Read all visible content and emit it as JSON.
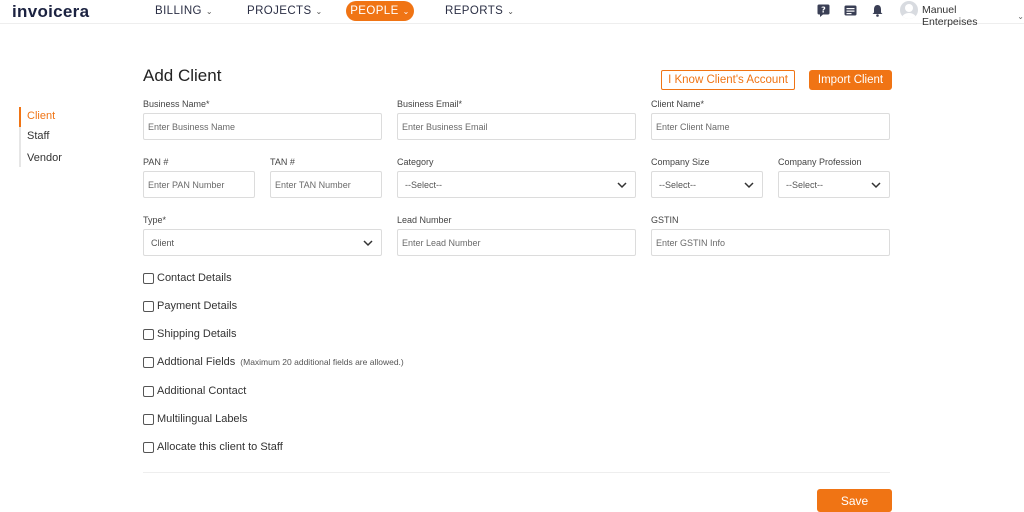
{
  "header": {
    "logo": "invoicera",
    "nav": [
      {
        "label": "BILLING"
      },
      {
        "label": "PROJECTS"
      },
      {
        "label": "PEOPLE"
      },
      {
        "label": "REPORTS"
      }
    ],
    "user_name": "Manuel Enterpeises",
    "icons": [
      "help-icon",
      "message-icon",
      "bell-icon",
      "avatar-icon"
    ]
  },
  "sidebar": {
    "items": [
      {
        "label": "Client"
      },
      {
        "label": "Staff"
      },
      {
        "label": "Vendor"
      }
    ]
  },
  "main": {
    "title": "Add Client",
    "know_account_label": "I Know Client's Account",
    "import_label": "Import Client",
    "fields": {
      "business_name": {
        "label": "Business Name*",
        "placeholder": "Enter Business Name"
      },
      "business_email": {
        "label": "Business Email*",
        "placeholder": "Enter Business Email"
      },
      "client_name": {
        "label": "Client Name*",
        "placeholder": "Enter Client Name"
      },
      "pan": {
        "label": "PAN #",
        "placeholder": "Enter PAN Number"
      },
      "tan": {
        "label": "TAN #",
        "placeholder": "Enter TAN Number"
      },
      "category": {
        "label": "Category",
        "value": "--Select--"
      },
      "company_size": {
        "label": "Company Size",
        "value": "--Select--"
      },
      "company_profession": {
        "label": "Company Profession",
        "value": "--Select--"
      },
      "type": {
        "label": "Type*",
        "value": "Client"
      },
      "lead_number": {
        "label": "Lead Number",
        "placeholder": "Enter Lead Number"
      },
      "gstin": {
        "label": "GSTIN",
        "placeholder": "Enter GSTIN Info"
      }
    },
    "checkboxes": [
      {
        "label": "Contact Details",
        "note": ""
      },
      {
        "label": "Payment Details",
        "note": ""
      },
      {
        "label": "Shipping Details",
        "note": ""
      },
      {
        "label": "Addtional Fields",
        "note": "(Maximum 20 additional fields are allowed.)"
      },
      {
        "label": "Additional Contact",
        "note": ""
      },
      {
        "label": "Multilingual Labels",
        "note": ""
      },
      {
        "label": "Allocate this client to Staff",
        "note": ""
      }
    ],
    "save_label": "Save"
  },
  "colors": {
    "accent": "#f07414",
    "text": "#333333",
    "border": "#dcdcdc"
  }
}
